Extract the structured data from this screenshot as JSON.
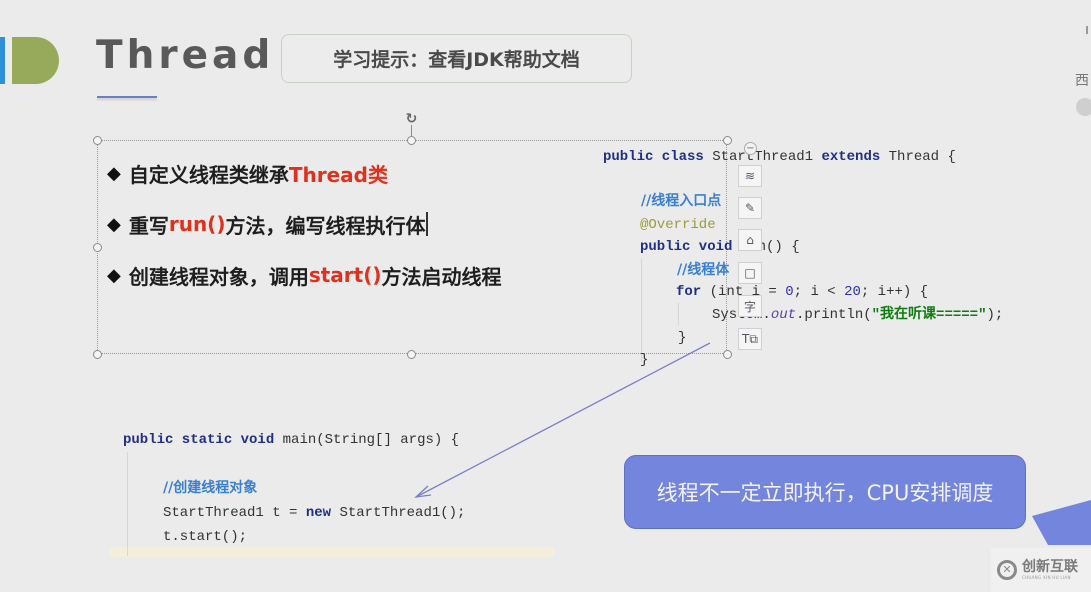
{
  "header": {
    "title": "Thread",
    "tip": "学习提示：查看JDK帮助文档",
    "edge_char": "西"
  },
  "bullets": [
    {
      "prefix": "自定义线程类继承",
      "highlight": "Thread类",
      "suffix": ""
    },
    {
      "prefix": "重写",
      "highlight": "run()",
      "suffix": "方法，编写线程执行体"
    },
    {
      "prefix": "创建线程对象，调用",
      "highlight": "start()",
      "suffix": "方法启动线程"
    }
  ],
  "class_code": {
    "line1": {
      "kw": "public class ",
      "name": "StartThread1 ",
      "kw2": "extends ",
      "rest": "Thread {"
    },
    "comment1": "//线程入口点",
    "annotation": "@Override",
    "line_run": {
      "kw": "public void ",
      "rest": "run() {"
    },
    "comment2": "//线程体",
    "line_for": {
      "kw": "for ",
      "a": "(int i = ",
      "n1": "0",
      "b": "; i < ",
      "n2": "20",
      "c": "; i++) {"
    },
    "line_print": {
      "a": "System.",
      "out": "out",
      "b": ".println(",
      "str": "\"我在听课=====\"",
      "c": ");"
    },
    "close_inner": "}",
    "close_outer": "}"
  },
  "main_code": {
    "line1": {
      "kw": "public static void ",
      "rest": "main(String[] args) {"
    },
    "comment": "//创建线程对象",
    "line_new": {
      "a": "StartThread1 t = ",
      "kw": "new ",
      "b": "StartThread1();"
    },
    "line_start": "t.start();"
  },
  "toolbar": {
    "minus": "−",
    "layers_icon": "≋",
    "pen_icon": "✎",
    "fill_icon": "⌂",
    "shape_icon": "□",
    "text_icon": "字",
    "textbox_icon": "T⧉"
  },
  "callout": {
    "text": "线程不一定立即执行，CPU安排调度"
  },
  "watermark": {
    "logo": "✕",
    "cn": "创新互联",
    "en": "CHUANG XIN HU LIAN"
  },
  "colors": {
    "accent_red": "#e0301e",
    "callout_bg": "#7485dd",
    "logo_green": "#97a95b",
    "logo_blue": "#2f8fd8"
  }
}
